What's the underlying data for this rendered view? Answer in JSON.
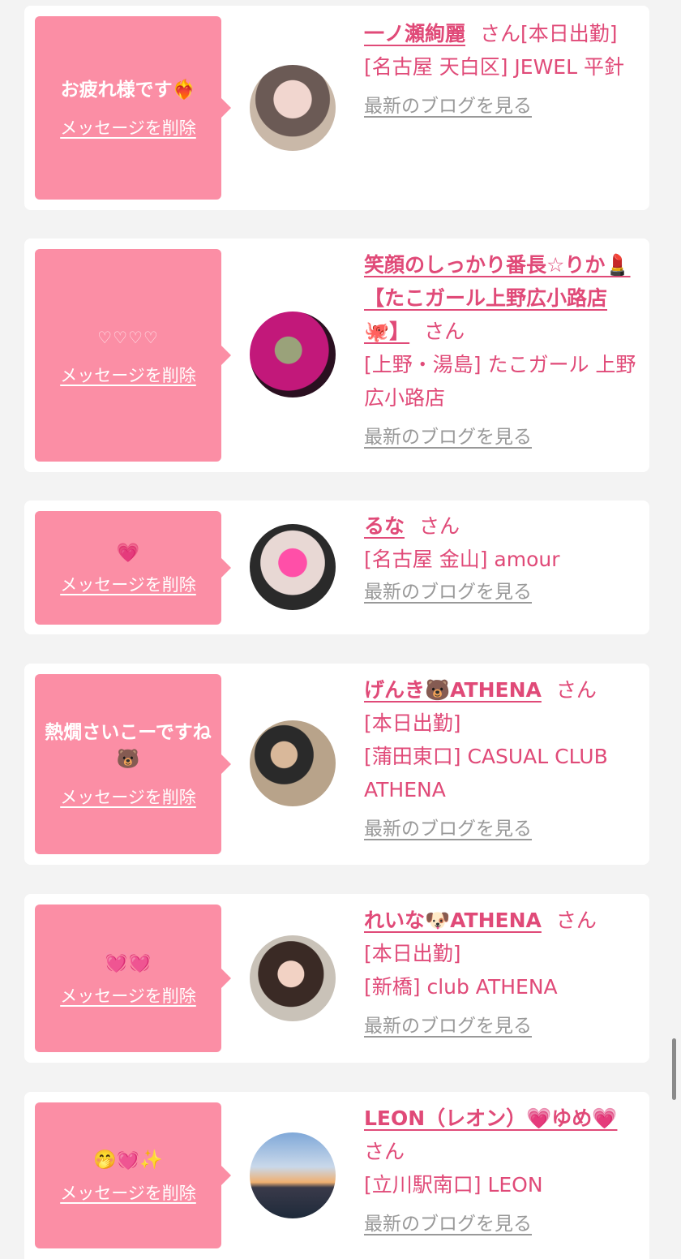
{
  "delete_label": "メッセージを削除",
  "blog_label": "最新のブログを見る",
  "honorific": "さん",
  "items": [
    {
      "message": "お疲れ様です❤️‍🔥",
      "name": "一ノ瀬絢麗",
      "status": "[本日出勤]",
      "shop": "[名古屋 天白区] JEWEL 平針"
    },
    {
      "message": "♡♡♡♡",
      "name": "笑顔のしっかり番長☆りか💄【たこガール上野広小路店🐙】",
      "status": "",
      "shop": "[上野・湯島] たこガール 上野広小路店"
    },
    {
      "message": "💗",
      "name": "るな",
      "status": "",
      "shop": "[名古屋 金山] amour"
    },
    {
      "message": "熱燗さいこーですね🐻",
      "name": "げんき🐻ATHENA",
      "status": "[本日出勤]",
      "shop": "[蒲田東口] CASUAL CLUB ATHENA"
    },
    {
      "message": "💓💓",
      "name": "れいな🐶ATHENA",
      "status": "[本日出勤]",
      "shop": "[新橋] club ATHENA"
    },
    {
      "message": "🤭💓✨",
      "name": "LEON（レオン）💗ゆめ💗",
      "status": "",
      "shop": "[立川駅南口] LEON"
    }
  ]
}
